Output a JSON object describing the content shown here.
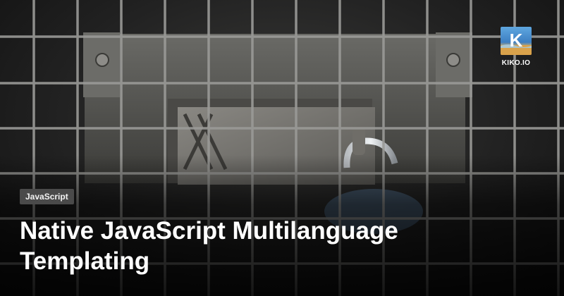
{
  "card": {
    "category_tag": "JavaScript",
    "title": "Native JavaScript Multilanguage Templating"
  },
  "brand": {
    "name": "KIKO.IO",
    "logo_letter": "K"
  },
  "colors": {
    "tag_background": "#4a4a4a",
    "title_text": "#ffffff",
    "logo_sky": "#4b93d6",
    "logo_sand": "#d9a24b"
  },
  "icons": {
    "brand_logo": "kiko-logo-icon",
    "background": "locked-grate-photo"
  }
}
